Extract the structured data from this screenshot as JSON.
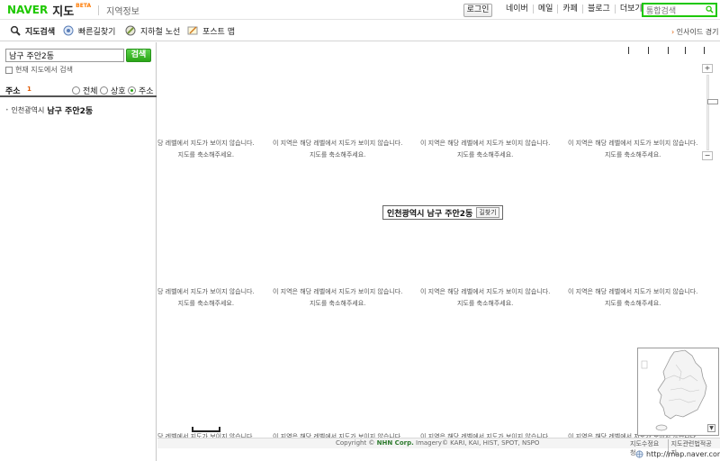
{
  "header": {
    "logo_naver": "NAVER",
    "logo_jido": "지도",
    "logo_beta": "BETA",
    "local_info": "지역정보",
    "login_label": "로그인",
    "links": [
      "네이버",
      "메일",
      "카페",
      "블로그",
      "더보기"
    ],
    "search_placeholder": "통합검색"
  },
  "toolbar": {
    "tools": [
      "지도검색",
      "빠른길찾기",
      "지하철 노선",
      "포스트 맵"
    ],
    "insight": "인사이드 경기"
  },
  "search": {
    "query": "남구 주안2동",
    "button": "검색",
    "within_label": "현재 지도에서 검색"
  },
  "results": {
    "label": "주소",
    "count": "1",
    "filters": [
      "전체",
      "상호",
      "주소"
    ],
    "selected_filter": "주소",
    "item_prefix": "인천광역시",
    "item_bold": "남구 주안2동"
  },
  "map": {
    "tile_line1": "이 지역은 해당 레벨에서 지도가 보이지 않습니다.",
    "tile_line2": "지도를 축소해주세요.",
    "tile_line1_clipped": "당 레벨에서 지도가 보이지 않습니다.",
    "tile_line1_bottom": "당 레벨에서 지도가 보이지 않습니다",
    "center_label": "인천광역시 남구 주안2동",
    "route_label": "길찾기",
    "zoom_in": "+",
    "zoom_out": "−",
    "minimap_close": "▼"
  },
  "footer": {
    "copyright_prefix": "Copyright ©",
    "copyright_corp": "NHN Corp.",
    "copyright_imagery": "Imagery© KARI, KAI, HIST, SPOT, NSPO",
    "links": [
      "지도수정요청",
      "지도관련법적공지"
    ]
  },
  "browser": {
    "url": "http://map.naver.com/"
  },
  "colors": {
    "brand_green": "#1ec800",
    "accent_orange": "#e05a00"
  }
}
